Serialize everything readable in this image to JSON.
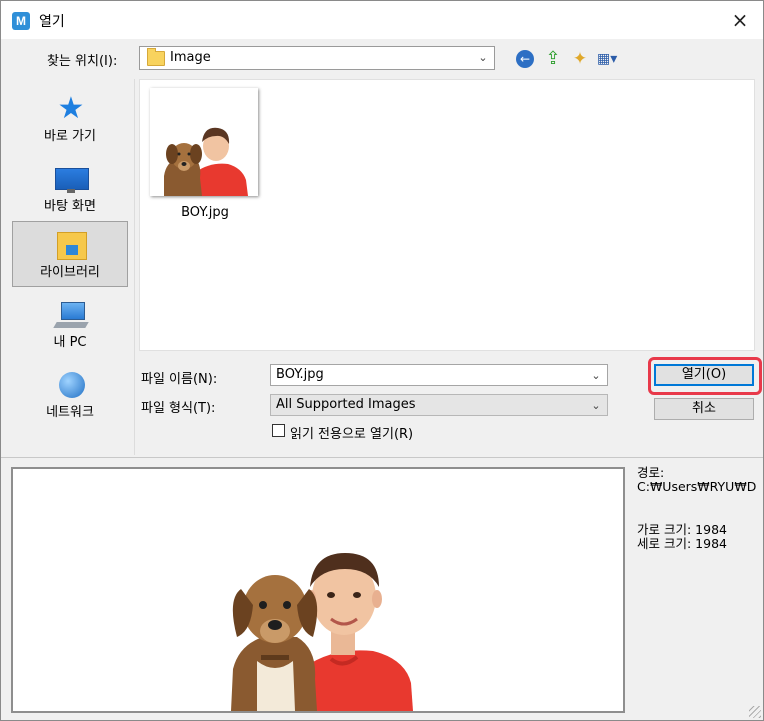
{
  "window": {
    "title": "열기",
    "close_icon": "×"
  },
  "location": {
    "label": "찾는 위치(I):",
    "value": "Image"
  },
  "toolbar": {
    "back_icon": "back-arrow-icon",
    "up_icon": "up-folder-icon",
    "new_folder_icon": "new-folder-icon",
    "view_icon": "view-menu-icon"
  },
  "places": [
    {
      "label": "바로 가기",
      "icon": "quick-access-star-icon"
    },
    {
      "label": "바탕 화면",
      "icon": "desktop-icon"
    },
    {
      "label": "라이브러리",
      "icon": "library-icon",
      "selected": true
    },
    {
      "label": "내 PC",
      "icon": "pc-icon"
    },
    {
      "label": "네트워크",
      "icon": "network-icon"
    }
  ],
  "files": [
    {
      "name": "BOY.jpg"
    }
  ],
  "form": {
    "filename_label": "파일 이름(N):",
    "filename_value": "BOY.jpg",
    "filetype_label": "파일 형식(T):",
    "filetype_value": "All Supported Images",
    "readonly_label": "읽기 전용으로 열기(R)",
    "open_button": "열기(O)",
    "cancel_button": "취소"
  },
  "preview": {
    "path_label": "경로:",
    "path_value": "C:₩Users₩RYU₩D",
    "width_text": "가로 크기: 1984",
    "height_text": "세로 크기: 1984"
  },
  "colors": {
    "highlight": "#e8394a",
    "accent": "#0078d7",
    "app_icon": "#2f8fd8"
  }
}
